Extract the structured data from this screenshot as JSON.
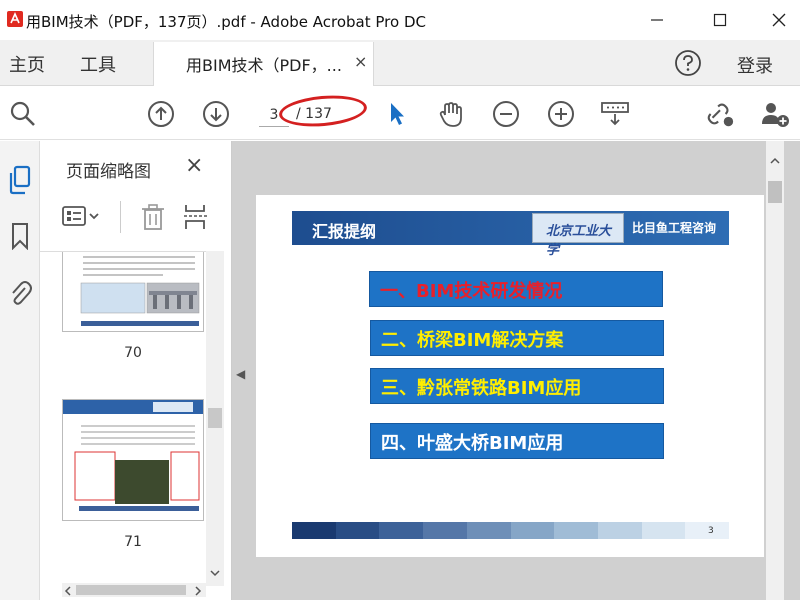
{
  "window": {
    "title": "用BIM技术（PDF，137页）.pdf - Adobe Acrobat Pro DC",
    "minimize_icon": "minimize-icon",
    "maximize_icon": "maximize-icon",
    "close_icon": "close-icon"
  },
  "tabbar": {
    "home_label": "主页",
    "tools_label": "工具",
    "doc_tab_label": "用BIM技术（PDF，...",
    "doc_tab_close": "×",
    "help_icon": "help-icon",
    "login_label": "登录"
  },
  "toolbar": {
    "current_page": "3",
    "total_pages": "/ 137",
    "icons": [
      "search-zoom-icon",
      "page-up-icon",
      "page-down-icon",
      "select-cursor-icon",
      "hand-tool-icon",
      "zoom-out-icon",
      "zoom-in-icon",
      "keyboard-scroll-icon",
      "share-link-icon",
      "add-user-icon"
    ]
  },
  "rail": {
    "icons": [
      "page-thumbnails-icon",
      "bookmark-icon",
      "attachment-icon"
    ]
  },
  "thumbnail_panel": {
    "title": "页面缩略图",
    "close": "×",
    "thumbnails": [
      {
        "page": "70"
      },
      {
        "page": "71"
      }
    ]
  },
  "slide": {
    "header_title": "汇报提纲",
    "logo_text": "北京工业大学",
    "brand": "比目鱼工程咨询",
    "items": [
      {
        "text": "一、BIM技术研发情况",
        "color": "#e8202a"
      },
      {
        "text": "二、桥梁BIM解决方案",
        "color": "#ffee00"
      },
      {
        "text": "三、黔张常铁路BIM应用",
        "color": "#ffee00"
      },
      {
        "text": "四、叶盛大桥BIM应用",
        "color": "#ffffff"
      }
    ],
    "page_number": "3",
    "footer_colors": [
      "#1a3a70",
      "#294d85",
      "#3d6299",
      "#5577a8",
      "#6e8fb8",
      "#86a6c7",
      "#a0bcd6",
      "#bcd1e4",
      "#d6e4f0",
      "#e8f0f8"
    ]
  },
  "colors": {
    "accent_blue": "#1e73c6",
    "annotation_red": "#d42020"
  }
}
